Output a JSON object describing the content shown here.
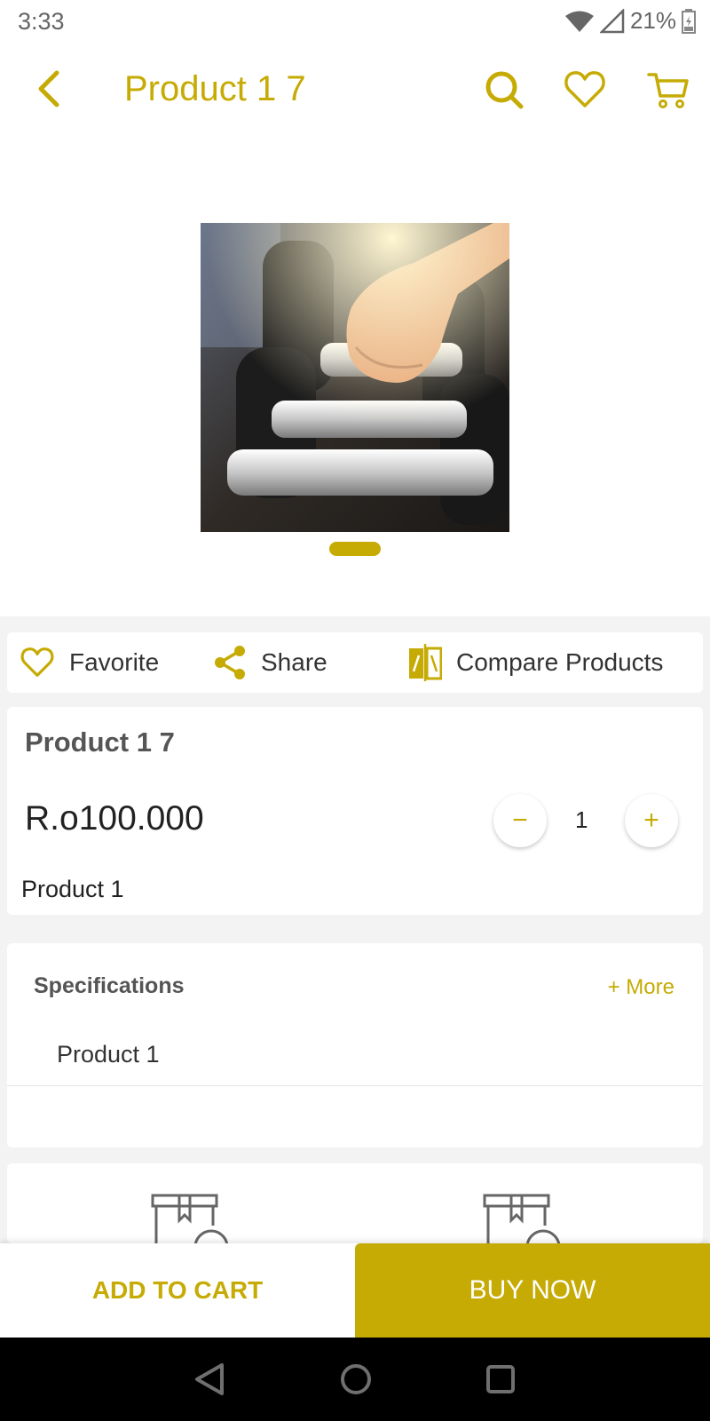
{
  "status_bar": {
    "time": "3:33",
    "battery": "21%"
  },
  "header": {
    "title": "Product 1 7",
    "icons": [
      "back-arrow-icon",
      "search-icon",
      "heart-icon",
      "cart-icon"
    ]
  },
  "actions": {
    "favorite": "Favorite",
    "share": "Share",
    "compare": "Compare Products"
  },
  "product": {
    "name": "Product 1 7",
    "price": "R.o100.000",
    "quantity": "1",
    "decrement": "−",
    "increment": "+",
    "description": "Product 1"
  },
  "specifications": {
    "title": "Specifications",
    "more": "+ More",
    "items": [
      "Product 1"
    ]
  },
  "bottom_bar": {
    "add_to_cart": "ADD TO CART",
    "buy_now": "BUY NOW"
  },
  "colors": {
    "accent": "#c6ab04",
    "background": "#f3f3f3"
  }
}
